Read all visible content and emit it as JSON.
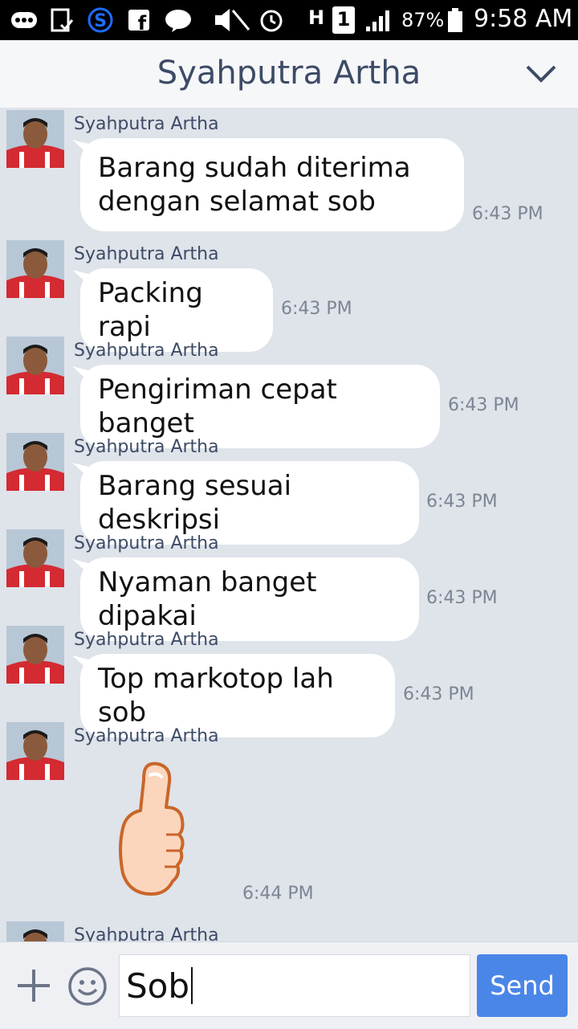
{
  "status_bar": {
    "battery": "87%",
    "time": "9:58 AM",
    "network": "H",
    "sim": "1"
  },
  "header": {
    "title": "Syahputra Artha"
  },
  "messages": [
    {
      "sender": "Syahputra Artha",
      "text_lines": [
        "Barang sudah diterima",
        "dengan selamat sob"
      ],
      "time": "6:43 PM"
    },
    {
      "sender": "Syahputra Artha",
      "text": "Packing rapi",
      "time": "6:43 PM"
    },
    {
      "sender": "Syahputra Artha",
      "text": "Pengiriman cepat banget",
      "time": "6:43 PM"
    },
    {
      "sender": "Syahputra Artha",
      "text": "Barang sesuai deskripsi",
      "time": "6:43 PM"
    },
    {
      "sender": "Syahputra Artha",
      "text": "Nyaman banget dipakai",
      "time": "6:43 PM"
    },
    {
      "sender": "Syahputra Artha",
      "text": "Top markotop lah sob",
      "time": "6:43 PM"
    },
    {
      "sender": "Syahputra Artha",
      "sticker": "thumbs-up",
      "time": "6:44 PM"
    },
    {
      "sender": "Syahputra Artha"
    }
  ],
  "input": {
    "value": "Sob",
    "send_label": "Send"
  },
  "colors": {
    "chat_background": "#dfe3ea",
    "send_button": "#4a86e8",
    "header_text": "#3d4b66"
  }
}
